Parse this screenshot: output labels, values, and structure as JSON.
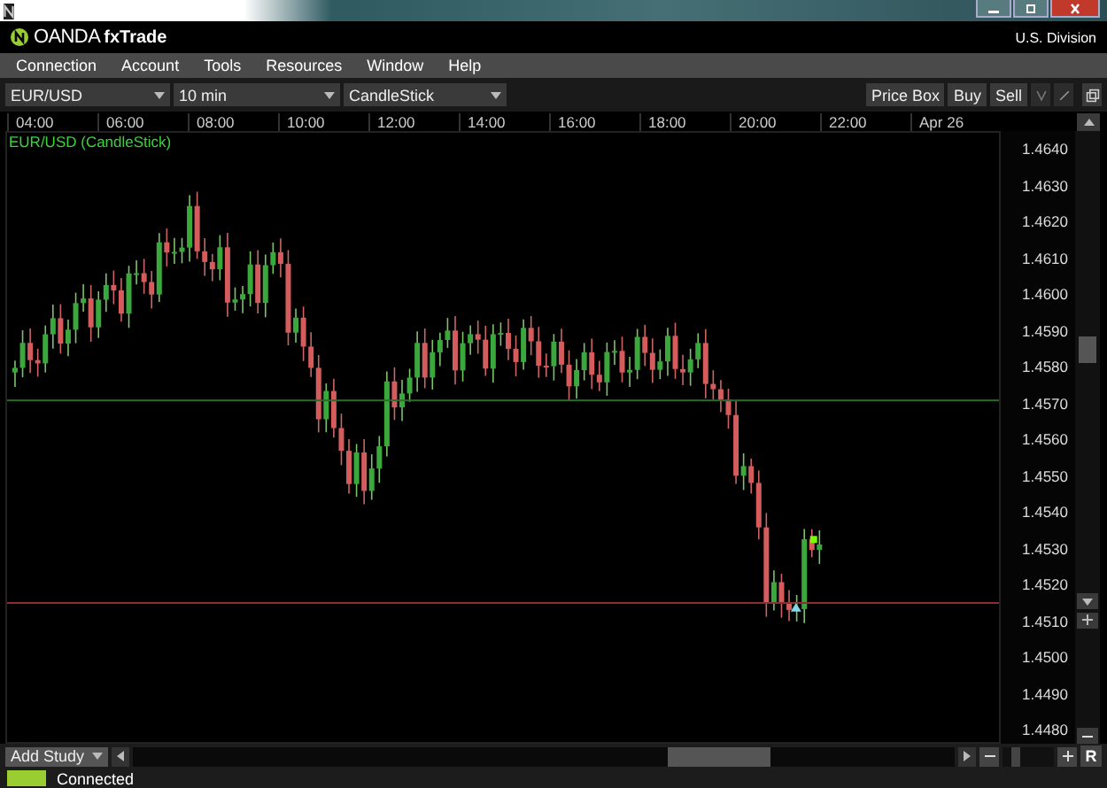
{
  "brand": {
    "name": "OANDA",
    "product": "fxTrade",
    "division": "U.S. Division"
  },
  "menu": [
    "Connection",
    "Account",
    "Tools",
    "Resources",
    "Window",
    "Help"
  ],
  "toolbar": {
    "dropdowns": [
      "EUR/USD",
      "10 min",
      "CandleStick"
    ],
    "buttons": [
      "Price Box",
      "Buy",
      "Sell"
    ]
  },
  "chart": {
    "legend": "EUR/USD (CandleStick)",
    "time_axis": [
      "04:00",
      "06:00",
      "08:00",
      "10:00",
      "12:00",
      "14:00",
      "16:00",
      "18:00",
      "20:00",
      "22:00",
      "Apr 26"
    ],
    "price_axis": [
      "1.4640",
      "1.4630",
      "1.4620",
      "1.4610",
      "1.4600",
      "1.4590",
      "1.4580",
      "1.4570",
      "1.4560",
      "1.4550",
      "1.4540",
      "1.4530",
      "1.4520",
      "1.4510",
      "1.4500",
      "1.4490",
      "1.4480"
    ]
  },
  "bottom_bar": {
    "add_study": "Add Study",
    "reset": "R",
    "zoom": {
      "level": 0.2
    }
  },
  "status_bar": {
    "text": "Connected",
    "connected": true
  }
}
